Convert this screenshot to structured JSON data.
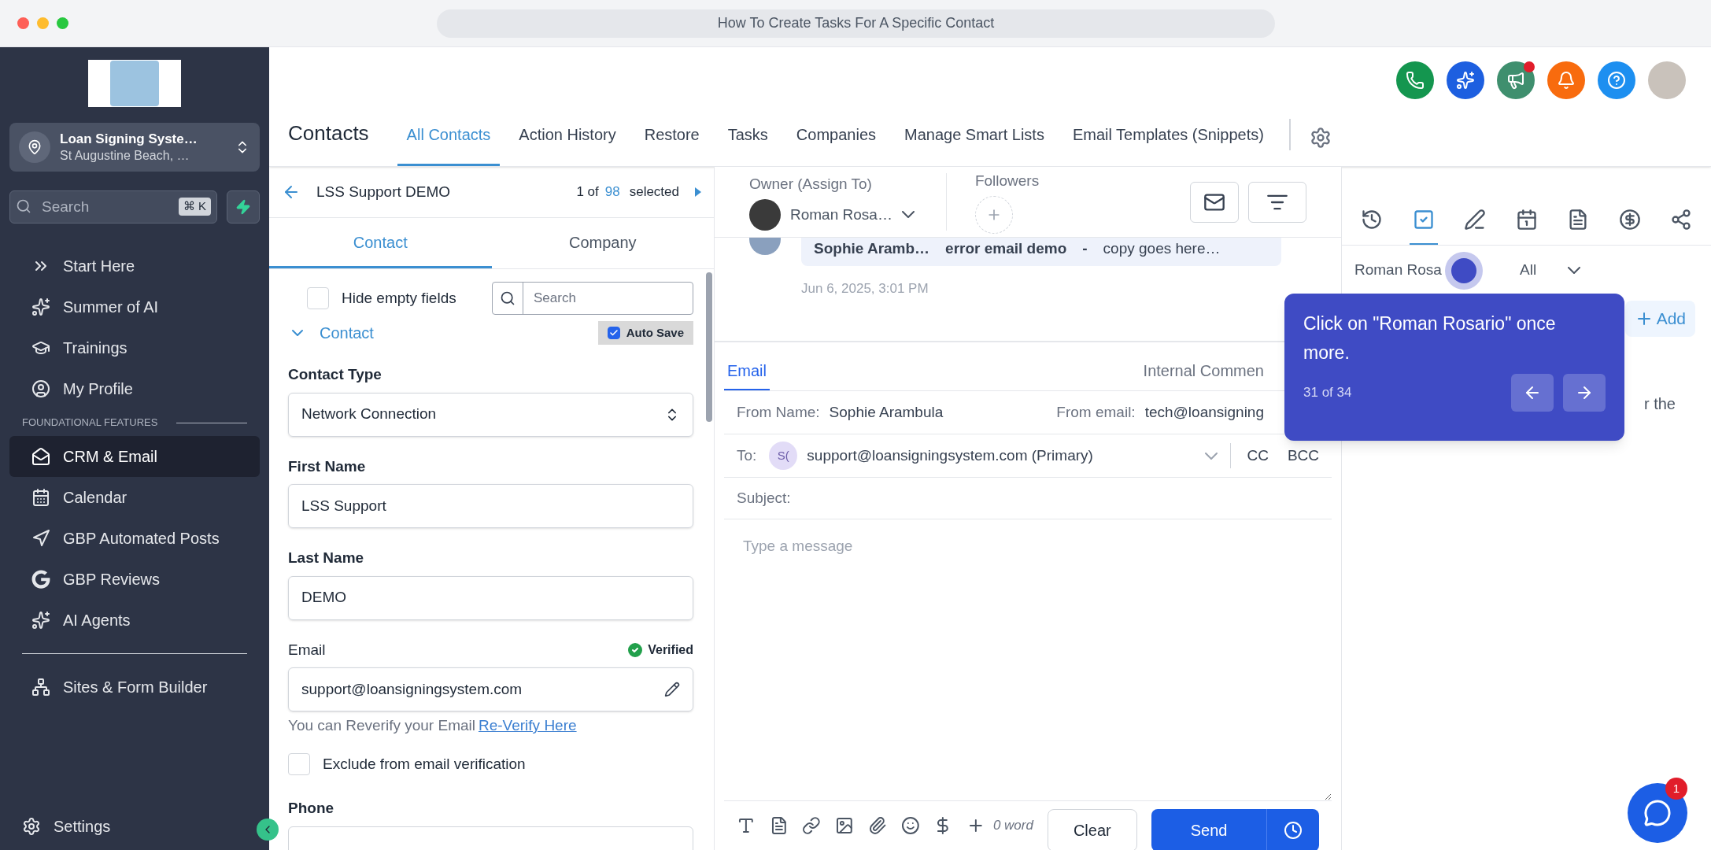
{
  "window": {
    "title": "How To Create Tasks For A Specific Contact"
  },
  "sidebar": {
    "account": {
      "name": "Loan Signing Syste…",
      "location": "St Augustine Beach, …"
    },
    "search": {
      "placeholder": "Search",
      "shortcut": "⌘ K"
    },
    "items": [
      {
        "label": "Start Here",
        "selected": false
      },
      {
        "label": "Summer of AI",
        "selected": false
      },
      {
        "label": "Trainings",
        "selected": false
      },
      {
        "label": "My Profile",
        "selected": false
      }
    ],
    "section": "FOUNDATIONAL FEATURES",
    "features": [
      {
        "label": "CRM & Email",
        "selected": true
      },
      {
        "label": "Calendar",
        "selected": false
      },
      {
        "label": "GBP Automated Posts",
        "selected": false
      },
      {
        "label": "GBP Reviews",
        "selected": false
      },
      {
        "label": "AI Agents",
        "selected": false
      }
    ],
    "bottom_items": [
      {
        "label": "Sites & Form Builder",
        "selected": false
      }
    ],
    "settings": "Settings"
  },
  "header": {
    "buttons": [
      {
        "unread": false
      },
      {
        "unread": false
      },
      {
        "unread": true
      },
      {
        "unread": false
      },
      {
        "unread": false
      }
    ],
    "title": "Contacts",
    "tabs": [
      {
        "label": "All Contacts",
        "selected": true
      },
      {
        "label": "Action History",
        "selected": false
      },
      {
        "label": "Restore",
        "selected": false
      },
      {
        "label": "Tasks",
        "selected": false
      },
      {
        "label": "Companies",
        "selected": false
      },
      {
        "label": "Manage Smart Lists",
        "selected": false
      },
      {
        "label": "Email Templates (Snippets)",
        "selected": false
      }
    ]
  },
  "contact_panel": {
    "name": "LSS Support DEMO",
    "position": "1 of",
    "count": "98",
    "selected_label": "selected",
    "tabs": [
      {
        "label": "Contact",
        "selected": true
      },
      {
        "label": "Company",
        "selected": false
      }
    ],
    "hide_empty": {
      "label": "Hide empty fields",
      "checked": false
    },
    "search": {
      "placeholder": "Search"
    },
    "section": {
      "label": "Contact",
      "expanded": true
    },
    "auto_save": {
      "label": "Auto Save",
      "checked": true
    },
    "contact_type": {
      "label": "Contact Type",
      "value": "Network Connection"
    },
    "first_name": {
      "label": "First Name",
      "value": "LSS Support"
    },
    "last_name": {
      "label": "Last Name",
      "value": "DEMO"
    },
    "email": {
      "label": "Email",
      "status": "Verified",
      "value": "support@loansigningsystem.com",
      "hint": "You can Reverify your Email",
      "link": "Re-Verify Here"
    },
    "exclude": {
      "label": "Exclude from email verification",
      "checked": false
    },
    "phone": {
      "label": "Phone"
    }
  },
  "conversation": {
    "owner_label": "Owner (Assign To)",
    "owner": "Roman Rosa…",
    "followers_label": "Followers",
    "message": {
      "sender": "Sophie Aramb…",
      "subject": "error email demo",
      "separator": "-",
      "preview": "copy goes here…",
      "date": "Jun 6, 2025, 3:01 PM"
    },
    "tabs": [
      {
        "label": "Email",
        "selected": true
      },
      {
        "label": "Internal Commen",
        "selected": false
      }
    ],
    "from_name_label": "From Name:",
    "from_name": "Sophie Arambula",
    "from_email_label": "From email:",
    "from_email": "tech@loansigning",
    "to_label": "To:",
    "to_initials": "S(",
    "to": "support@loansigningsystem.com (Primary)",
    "cc": "CC",
    "bcc": "BCC",
    "subject_label": "Subject:",
    "message_placeholder": "Type a message",
    "word_count": "0 word",
    "clear": "Clear",
    "send": "Send"
  },
  "activity": {
    "tabs": [
      {
        "selected": false
      },
      {
        "selected": true
      },
      {
        "selected": false
      },
      {
        "selected": false
      },
      {
        "selected": false
      },
      {
        "selected": false
      },
      {
        "selected": false
      }
    ],
    "assignee": "Roman Rosa",
    "status": "All",
    "add": "Add",
    "body_fragment": "r the"
  },
  "tour": {
    "text": "Click on \"Roman Rosario\" once more.",
    "step": "31 of 34"
  },
  "chat": {
    "badge": "1"
  }
}
